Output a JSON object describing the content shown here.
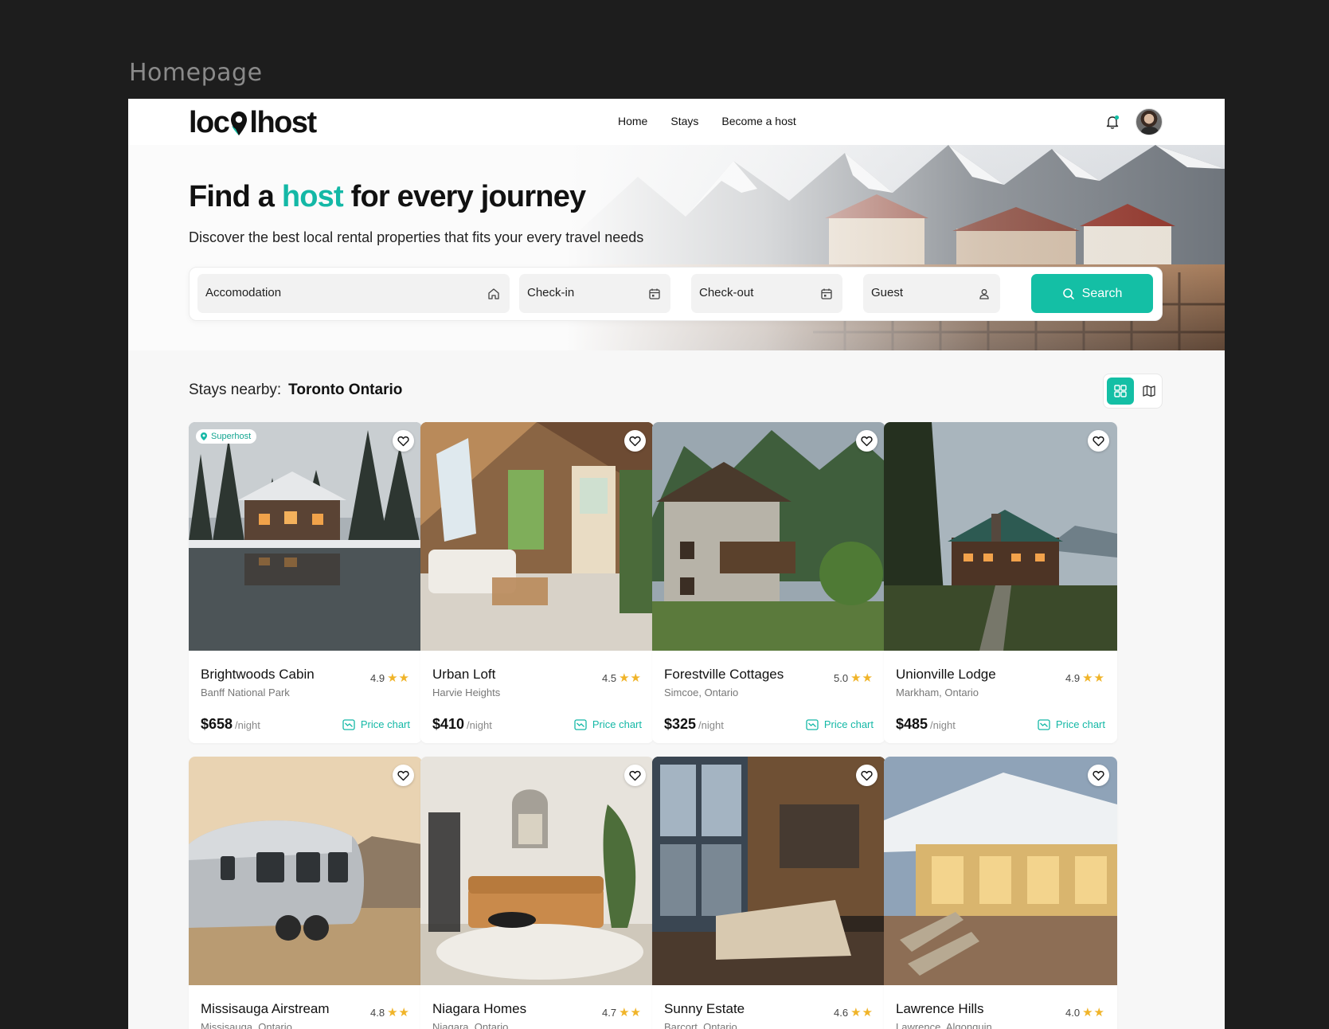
{
  "frame_label": "Homepage",
  "header": {
    "logo": {
      "left": "loc",
      "right": "lhost"
    },
    "nav": [
      "Home",
      "Stays",
      "Become a host"
    ]
  },
  "hero": {
    "title_pre": "Find a",
    "title_accent": "host",
    "title_post": "for every journey",
    "subtitle": "Discover the best local rental properties that fits your every travel needs"
  },
  "search": {
    "accommodation": "Accomodation",
    "checkin": "Check-in",
    "checkout": "Check-out",
    "guest": "Guest",
    "button": "Search"
  },
  "stays": {
    "label": "Stays nearby:",
    "location": "Toronto Ontario"
  },
  "card_labels": {
    "per_night": "/night",
    "price_chart": "Price chart",
    "superhost": "Superhost"
  },
  "listings": [
    {
      "name": "Brightwoods Cabin",
      "location": "Banff National Park",
      "rating": "4.9",
      "price": "$658",
      "superhost": true
    },
    {
      "name": "Urban Loft",
      "location": "Harvie Heights",
      "rating": "4.5",
      "price": "$410",
      "superhost": false
    },
    {
      "name": "Forestville Cottages",
      "location": "Simcoe, Ontario",
      "rating": "5.0",
      "price": "$325",
      "superhost": false
    },
    {
      "name": "Unionville Lodge",
      "location": "Markham, Ontario",
      "rating": "4.9",
      "price": "$485",
      "superhost": false
    },
    {
      "name": "Missisauga Airstream",
      "location": "Missisauga, Ontario",
      "rating": "4.8",
      "price": "",
      "superhost": false
    },
    {
      "name": "Niagara Homes",
      "location": "Niagara, Ontario",
      "rating": "4.7",
      "price": "",
      "superhost": false
    },
    {
      "name": "Sunny Estate",
      "location": "Barcort, Ontario",
      "rating": "4.6",
      "price": "",
      "superhost": false
    },
    {
      "name": "Lawrence Hills",
      "location": "Lawrence, Algonquin",
      "rating": "4.0",
      "price": "",
      "superhost": false
    }
  ],
  "colors": {
    "accent": "#14bfa5",
    "star": "#f0b429",
    "frame_bg": "#1d1d1d"
  }
}
